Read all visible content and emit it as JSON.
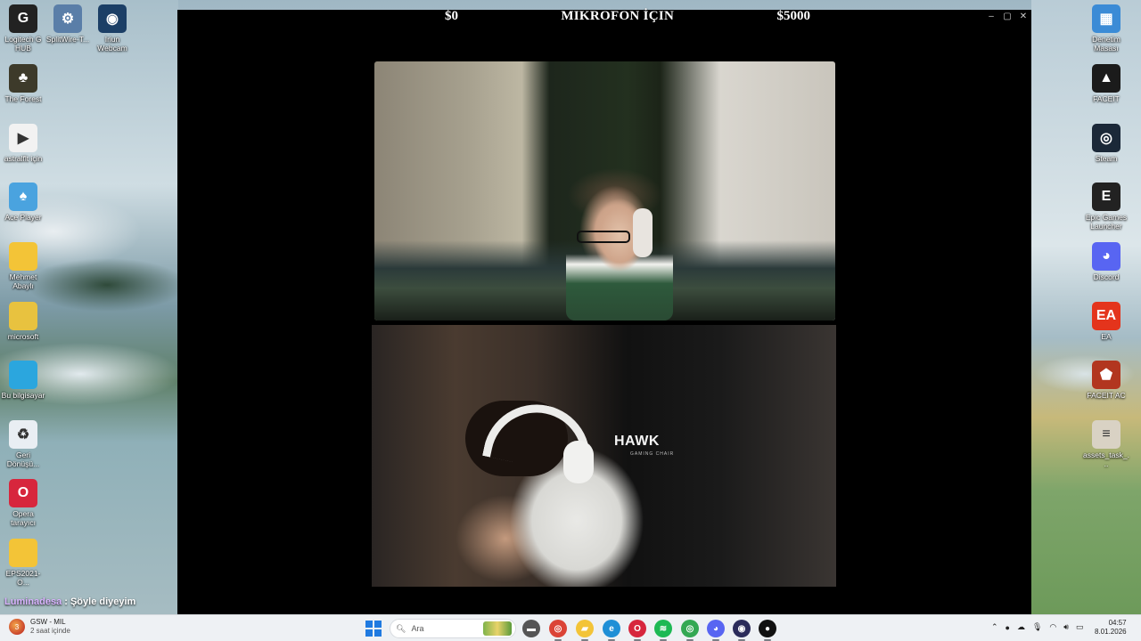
{
  "desktop": {
    "left_icons": [
      {
        "label": "Logitech G HUB",
        "icon": "logitech-icon",
        "color": "#222222",
        "glyph": "G"
      },
      {
        "label": "SplitWire-T...",
        "icon": "splitwire-icon",
        "color": "#5a7ea8",
        "glyph": "⚙"
      },
      {
        "label": "Iriun Webcam",
        "icon": "webcam-icon",
        "color": "#1c3f66",
        "glyph": "◉"
      },
      {
        "label": "The Forest",
        "icon": "the-forest-icon",
        "color": "#3d3a2a",
        "glyph": "♣"
      },
      {
        "label": "astralflt için",
        "icon": "media-file-icon",
        "color": "#f2f2f2",
        "glyph": "▶"
      },
      {
        "label": "Ace Player",
        "icon": "ace-player-icon",
        "color": "#4aa3df",
        "glyph": "♠"
      },
      {
        "label": "Mehmet Abaylı",
        "icon": "folder-icon",
        "color": "#f3c437",
        "glyph": ""
      },
      {
        "label": "microsoft",
        "icon": "folder-icon",
        "color": "#e8c23f",
        "glyph": ""
      },
      {
        "label": "Bu bilgisayar",
        "icon": "computer-icon",
        "color": "#2ba6de",
        "glyph": ""
      },
      {
        "label": "Geri Dönüşü...",
        "icon": "recycle-bin-icon",
        "color": "#e9eef3",
        "glyph": "♻"
      },
      {
        "label": "Opera tarayıcı",
        "icon": "opera-icon",
        "color": "#d7263d",
        "glyph": "O"
      },
      {
        "label": "EPS2021-O...",
        "icon": "folder-icon",
        "color": "#f3c437",
        "glyph": ""
      }
    ],
    "right_icons": [
      {
        "label": "Denetim Masası",
        "icon": "control-panel-icon",
        "color": "#3b8bd6",
        "glyph": "▦"
      },
      {
        "label": "FACEIT",
        "icon": "faceit-icon",
        "color": "#1b1b1b",
        "glyph": "▲"
      },
      {
        "label": "Steam",
        "icon": "steam-icon",
        "color": "#1b2838",
        "glyph": "◎"
      },
      {
        "label": "Epic Games Launcher",
        "icon": "epic-games-icon",
        "color": "#222222",
        "glyph": "E"
      },
      {
        "label": "Discord",
        "icon": "discord-icon",
        "color": "#5865f2",
        "glyph": "◕"
      },
      {
        "label": "EA",
        "icon": "ea-icon",
        "color": "#e4341c",
        "glyph": "EA"
      },
      {
        "label": "FACEIT AC",
        "icon": "faceit-ac-icon",
        "color": "#b2361f",
        "glyph": "⬟"
      },
      {
        "label": "assets_task_...",
        "icon": "file-icon",
        "color": "#d9d2c4",
        "glyph": "≡"
      }
    ]
  },
  "stream": {
    "overlay_left": "$0",
    "overlay_center": "MIKROFON İÇIN",
    "overlay_right": "$5000",
    "bottom_chair_brand": "HAWK",
    "bottom_chair_sub": "GAMING CHAIR",
    "window_controls": [
      "–",
      "▢",
      "✕"
    ]
  },
  "chat": {
    "user": "Luminadesa",
    "separator": " : ",
    "message": "Şöyle diyeyim"
  },
  "taskbar": {
    "weather_title": "GSW - MIL",
    "weather_sub": "2 saat içinde",
    "weather_badge": "3",
    "search_placeholder": "Ara",
    "apps": [
      {
        "name": "file-explorer-app",
        "icon": "file-explorer-icon",
        "color": "#555555",
        "glyph": "▬"
      },
      {
        "name": "chrome-app",
        "icon": "chrome-icon",
        "color": "#db4437",
        "glyph": "◎"
      },
      {
        "name": "folder-app",
        "icon": "folder-icon",
        "color": "#f3c437",
        "glyph": "▰"
      },
      {
        "name": "edge-app",
        "icon": "edge-icon",
        "color": "#1f8fd6",
        "glyph": "e"
      },
      {
        "name": "opera-app",
        "icon": "opera-icon",
        "color": "#d7263d",
        "glyph": "O"
      },
      {
        "name": "spotify-app",
        "icon": "spotify-icon",
        "color": "#1db954",
        "glyph": "≋"
      },
      {
        "name": "chrome-profile-app",
        "icon": "chrome-icon",
        "color": "#34a853",
        "glyph": "◎"
      },
      {
        "name": "discord-app",
        "icon": "discord-icon",
        "color": "#5865f2",
        "glyph": "◕"
      },
      {
        "name": "obs-app",
        "icon": "obs-icon",
        "color": "#2b2b5a",
        "glyph": "◉"
      },
      {
        "name": "github-app",
        "icon": "github-icon",
        "color": "#111111",
        "glyph": "●"
      }
    ],
    "tray_icons": [
      "chevron-up-icon",
      "edge-tray-icon",
      "onedrive-icon",
      "microphone-icon",
      "wifi-icon",
      "volume-icon",
      "battery-icon"
    ],
    "time": "04:57",
    "date": "8.01.2026"
  }
}
